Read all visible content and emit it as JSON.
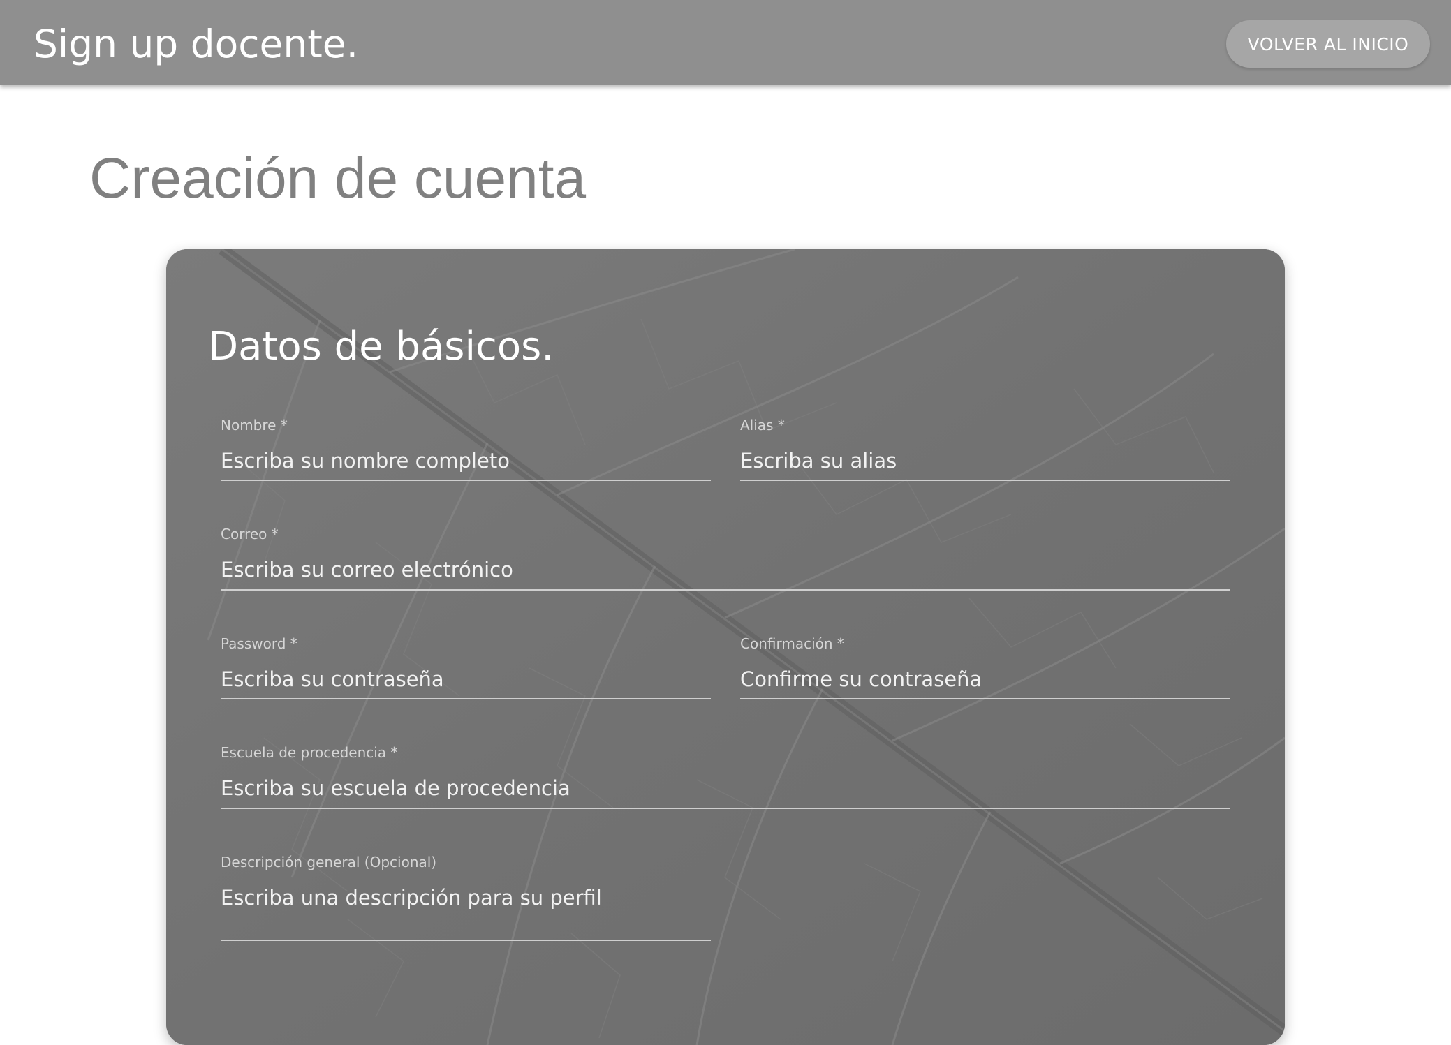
{
  "header": {
    "title": "Sign up docente.",
    "home_button_label": "VOLVER AL INICIO"
  },
  "page": {
    "title": "Creación de cuenta"
  },
  "form": {
    "section_title": "Datos de básicos.",
    "fields": {
      "nombre": {
        "label": "Nombre *",
        "placeholder": "Escriba su nombre completo",
        "value": ""
      },
      "alias": {
        "label": "Alias *",
        "placeholder": "Escriba su alias",
        "value": ""
      },
      "correo": {
        "label": "Correo *",
        "placeholder": "Escriba su correo electrónico",
        "value": ""
      },
      "password": {
        "label": "Password *",
        "placeholder": "Escriba su contraseña",
        "value": ""
      },
      "confirmacion": {
        "label": "Confirmación *",
        "placeholder": "Confirme su contraseña",
        "value": ""
      },
      "escuela": {
        "label": "Escuela de procedencia *",
        "placeholder": "Escriba su escuela de procedencia",
        "value": ""
      },
      "descripcion": {
        "label": "Descripción general (Opcional)",
        "placeholder": "Escriba una descripción para su perfil",
        "value": ""
      }
    }
  },
  "colors": {
    "header_background": "#8f8f8f",
    "card_background": "#767676",
    "page_title": "#808080",
    "field_line": "#cfcfcf"
  }
}
